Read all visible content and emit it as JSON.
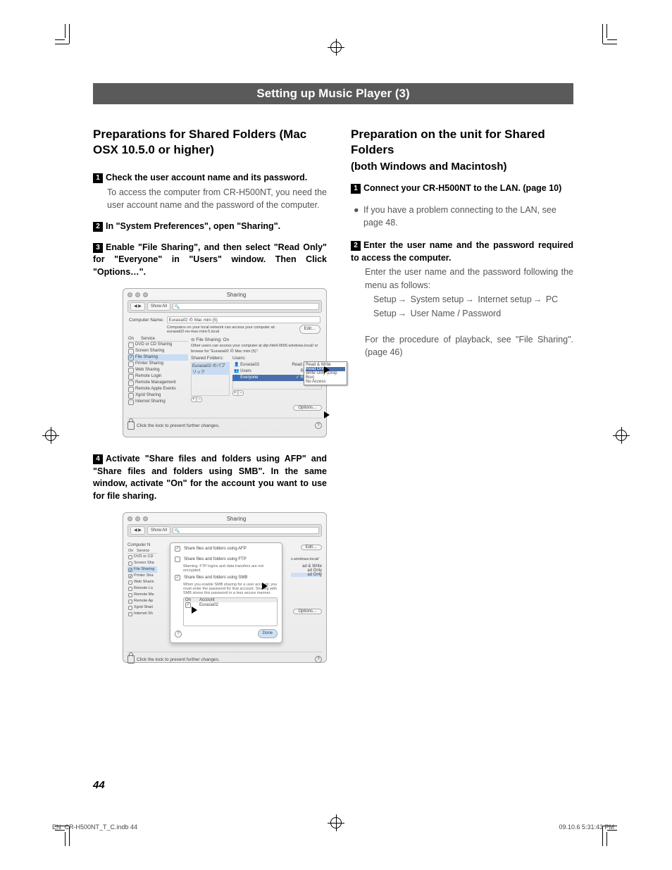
{
  "banner": "Setting up Music Player (3)",
  "left": {
    "heading": "Preparations for Shared Folders (Mac OSX 10.5.0 or higher)",
    "steps": [
      {
        "num": "1",
        "head": "Check the user account name and its password.",
        "body": "To access the computer from CR-H500NT, you need the user account name and the password of the computer."
      },
      {
        "num": "2",
        "head": "In \"System Preferences\", open \"Sharing\"."
      },
      {
        "num": "3",
        "head": "Enable \"File Sharing\", and then select \"Read Only\" for \"Everyone\" in \"Users\" window. Then Click \"Options…\"."
      },
      {
        "num": "4",
        "head": "Activate \"Share files and folders using AFP\" and \"Share files and folders using SMB\". In the same window, activate \"On\" for the account you want to use for file sharing."
      }
    ]
  },
  "right": {
    "heading": "Preparation on the unit for Shared Folders",
    "subheading": "(both Windows and Macintosh)",
    "step1": {
      "num": "1",
      "head": "Connect your CR-H500NT to the LAN. (page 10)"
    },
    "bullet": "If you have a problem connecting to the LAN, see page 48.",
    "step2": {
      "num": "2",
      "head": "Enter the user name and the password required to access the computer.",
      "body": "Enter the user name and the password following the menu as follows:"
    },
    "path1": [
      "Setup",
      "System setup",
      "Internet setup",
      "PC Setup",
      "User Name / Password"
    ],
    "closing": "For the procedure of playback, see \"File Sharing\". (page 46)"
  },
  "ss1": {
    "title": "Sharing",
    "showall": "Show All",
    "compname_label": "Computer Name:",
    "compname_value": "Eurasia02 の Mac mini (5)",
    "compname_note_l1": "Computers on your local network can access your computer at:",
    "compname_note_l2": "eurasia02-no-mac-mini-5.local",
    "edit": "Edit…",
    "cols": {
      "on": "On",
      "service": "Service"
    },
    "services": [
      "DVD or CD Sharing",
      "Screen Sharing",
      "File Sharing",
      "Printer Sharing",
      "Web Sharing",
      "Remote Login",
      "Remote Management",
      "Remote Apple Events",
      "Xgrid Sharing",
      "Internet Sharing"
    ],
    "selected_service_index": 2,
    "checked_services": [
      2
    ],
    "status_head": "File Sharing: On",
    "status_note": "Other users can access your computer at afp://dell-0655.windows.local/ or browse for \"Eurasia02 の Mac mini (5)\".",
    "shared_label": "Shared Folders:",
    "shared_folder": "Eurasia02 のパブリック",
    "users_label": "Users:",
    "users": [
      {
        "name": "Eurasia02",
        "perm": "Read & Write"
      },
      {
        "name": "Users",
        "perm": "Read Only"
      },
      {
        "name": "Everyone",
        "perm": "Read Only"
      }
    ],
    "perm_menu": [
      "Read & Write",
      "Read Only",
      "Write Only (Drop Box)",
      "No Access"
    ],
    "options": "Options…",
    "lock": "Click the lock to prevent further changes."
  },
  "ss2": {
    "title": "Sharing",
    "showall": "Show All",
    "compname_label": "Computer N",
    "afp": "Share files and folders using AFP",
    "ftp": "Share files and folders using FTP",
    "ftp_warn": "Warning: FTP logins and data transfers are not encrypted.",
    "smb": "Share files and folders using SMB",
    "smb_note": "When you enable SMB sharing for a user account, you must enter the password for that account. Sharing with SMB stores this password in a less secure manner.",
    "ac_on": "On",
    "ac_account": "Account",
    "ac_name": "Eurasia02",
    "done": "Done",
    "edit": "Edit…",
    "options": "Options…",
    "services": [
      "Service",
      "DVD or CD",
      "Screen Sha",
      "File Sharing",
      "Printer Sha",
      "Web Sharin",
      "Remote Lo",
      "Remote Ma",
      "Remote Ap",
      "Xgrid Shari",
      "Internet Sh"
    ],
    "right_perms": [
      "ad & Write",
      "ad Only",
      "ad Only"
    ],
    "right_note": "s.windows.local/",
    "lock": "Click the lock to prevent further changes."
  },
  "page_number": "44",
  "footer_left": "EN_CR-H500NT_T_C.indb   44",
  "footer_right": "09.10.6   5:31:43 PM"
}
